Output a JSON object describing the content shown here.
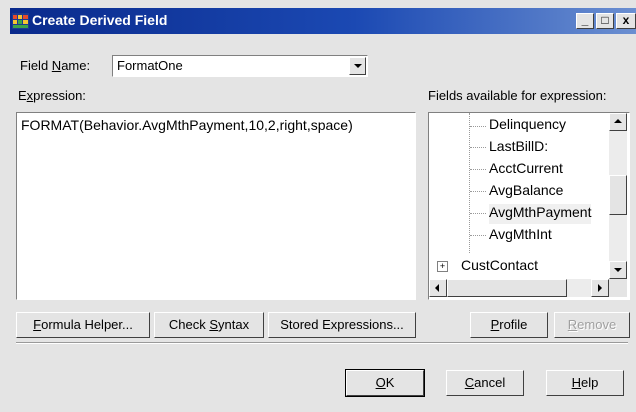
{
  "window": {
    "title": "Create Derived Field",
    "controls": {
      "minimize": "_",
      "maximize": "□",
      "close": "x"
    }
  },
  "field_name": {
    "label_pre": "Field ",
    "label_accel": "N",
    "label_post": "ame:",
    "value": "FormatOne"
  },
  "expression": {
    "label_pre": "E",
    "label_accel": "x",
    "label_post": "pression:",
    "value": "FORMAT(Behavior.AvgMthPayment,10,2,right,space)"
  },
  "fields_panel": {
    "label": "Fields available for expression:",
    "items": [
      {
        "label": "Delinquency"
      },
      {
        "label": "LastBillD:"
      },
      {
        "label": "AcctCurrent"
      },
      {
        "label": "AvgBalance"
      },
      {
        "label": "AvgMthPayment",
        "selected": true
      },
      {
        "label": "AvgMthInt"
      }
    ],
    "root": {
      "expander": "+",
      "label": "CustContact"
    }
  },
  "buttons": {
    "formula_helper": {
      "accel": "F",
      "rest": "ormula Helper..."
    },
    "check_syntax": {
      "pre": "Check ",
      "accel": "S",
      "rest": "yntax"
    },
    "stored_expressions": "Stored Expressions...",
    "profile": {
      "accel": "P",
      "rest": "rofile"
    },
    "remove": {
      "accel": "R",
      "rest": "emove"
    },
    "ok": {
      "accel": "O",
      "rest": "K"
    },
    "cancel": {
      "accel": "C",
      "rest": "ancel"
    },
    "help": {
      "accel": "H",
      "rest": "elp"
    }
  },
  "colors": {
    "titlebar_start": "#0a2a8c",
    "titlebar_end": "#6b8fd1",
    "dialog_bg": "#e4e4e4"
  }
}
